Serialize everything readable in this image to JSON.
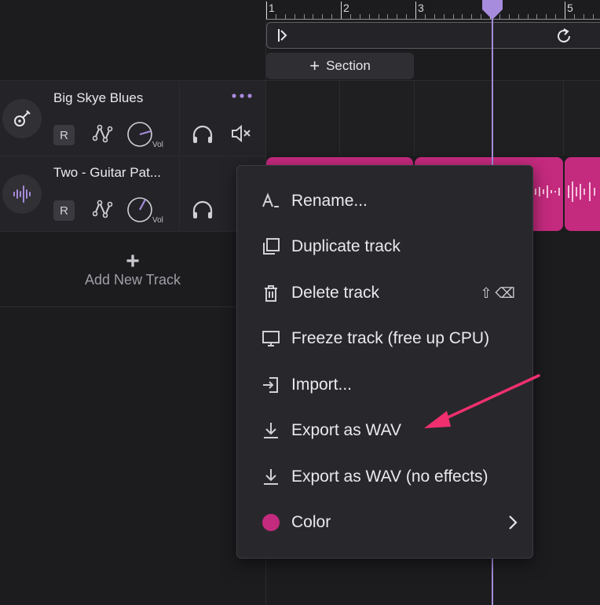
{
  "ruler": {
    "bars": [
      "1",
      "2",
      "3",
      "5"
    ]
  },
  "section_button": {
    "label": "Section"
  },
  "tracks": [
    {
      "name": "Big Skye Blues",
      "rec_label": "R",
      "vol_label": "Vol",
      "icon": "guitar-icon"
    },
    {
      "name": "Two - Guitar Pat...",
      "rec_label": "R",
      "vol_label": "Vol",
      "icon": "waveform-icon"
    }
  ],
  "add_track": {
    "label": "Add New Track"
  },
  "context_menu": {
    "items": [
      {
        "label": "Rename...",
        "icon": "rename-icon"
      },
      {
        "label": "Duplicate track",
        "icon": "duplicate-icon"
      },
      {
        "label": "Delete track",
        "icon": "trash-icon",
        "shortcut": "⇧⌫"
      },
      {
        "label": "Freeze track (free up CPU)",
        "icon": "monitor-icon"
      },
      {
        "label": "Import...",
        "icon": "import-icon"
      },
      {
        "label": "Export as WAV",
        "icon": "download-icon"
      },
      {
        "label": "Export as WAV (no effects)",
        "icon": "download-icon"
      },
      {
        "label": "Color",
        "icon": "color-swatch",
        "color": "#c42a7e"
      }
    ]
  },
  "colors": {
    "accent": "#a78bdc",
    "clip": "#c42a7e",
    "annotation_arrow": "#f0306e"
  }
}
